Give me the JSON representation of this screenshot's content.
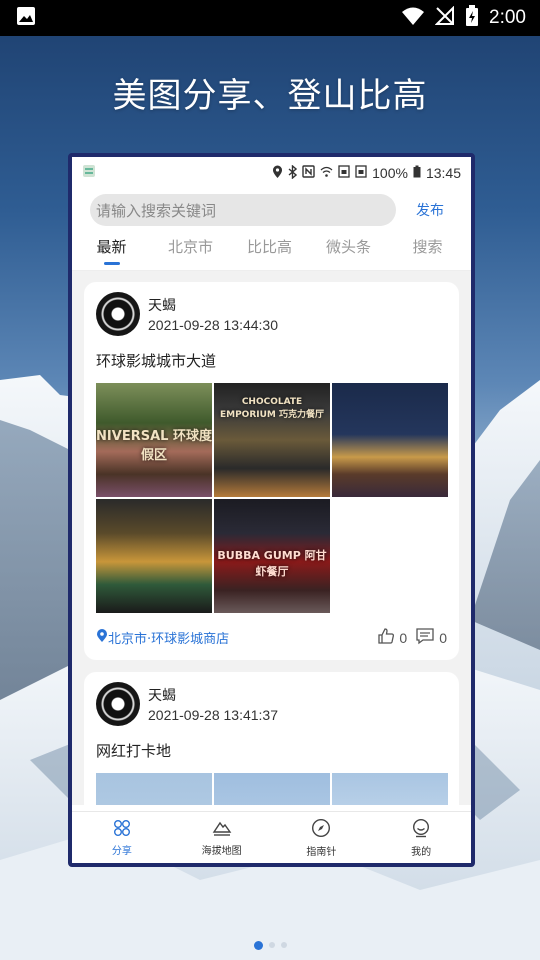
{
  "status_bar": {
    "time": "2:00"
  },
  "headline": "美图分享、登山比高",
  "inner_status": {
    "battery": "100%",
    "time": "13:45"
  },
  "search": {
    "placeholder": "请输入搜索关键词",
    "publish_label": "发布"
  },
  "tabs": [
    {
      "label": "最新",
      "active": true
    },
    {
      "label": "北京市"
    },
    {
      "label": "比比高"
    },
    {
      "label": "微头条"
    },
    {
      "label": "搜索"
    }
  ],
  "posts": [
    {
      "author": "天蝎",
      "time": "2021-09-28 13:44:30",
      "title": "环球影城城市大道",
      "photo_labels": [
        "NIVERSAL 环球度假区",
        "CHOCOLATE EMPORIUM 巧克力餐厅",
        "",
        "",
        "BUBBA GUMP 阿甘虾餐厅"
      ],
      "location": "北京市·环球影城商店",
      "likes": "0",
      "comments": "0"
    },
    {
      "author": "天蝎",
      "time": "2021-09-28 13:41:37",
      "title": "网红打卡地"
    }
  ],
  "bottom_nav": [
    {
      "label": "分享",
      "icon": "share-icon",
      "active": true
    },
    {
      "label": "海拔地图",
      "icon": "mountain-icon"
    },
    {
      "label": "指南针",
      "icon": "compass-icon"
    },
    {
      "label": "我的",
      "icon": "profile-icon"
    }
  ],
  "carousel": {
    "page_count": 3,
    "active_index": 0
  },
  "colors": {
    "accent": "#2a73d6",
    "phone_frame": "#1f2a6b"
  }
}
